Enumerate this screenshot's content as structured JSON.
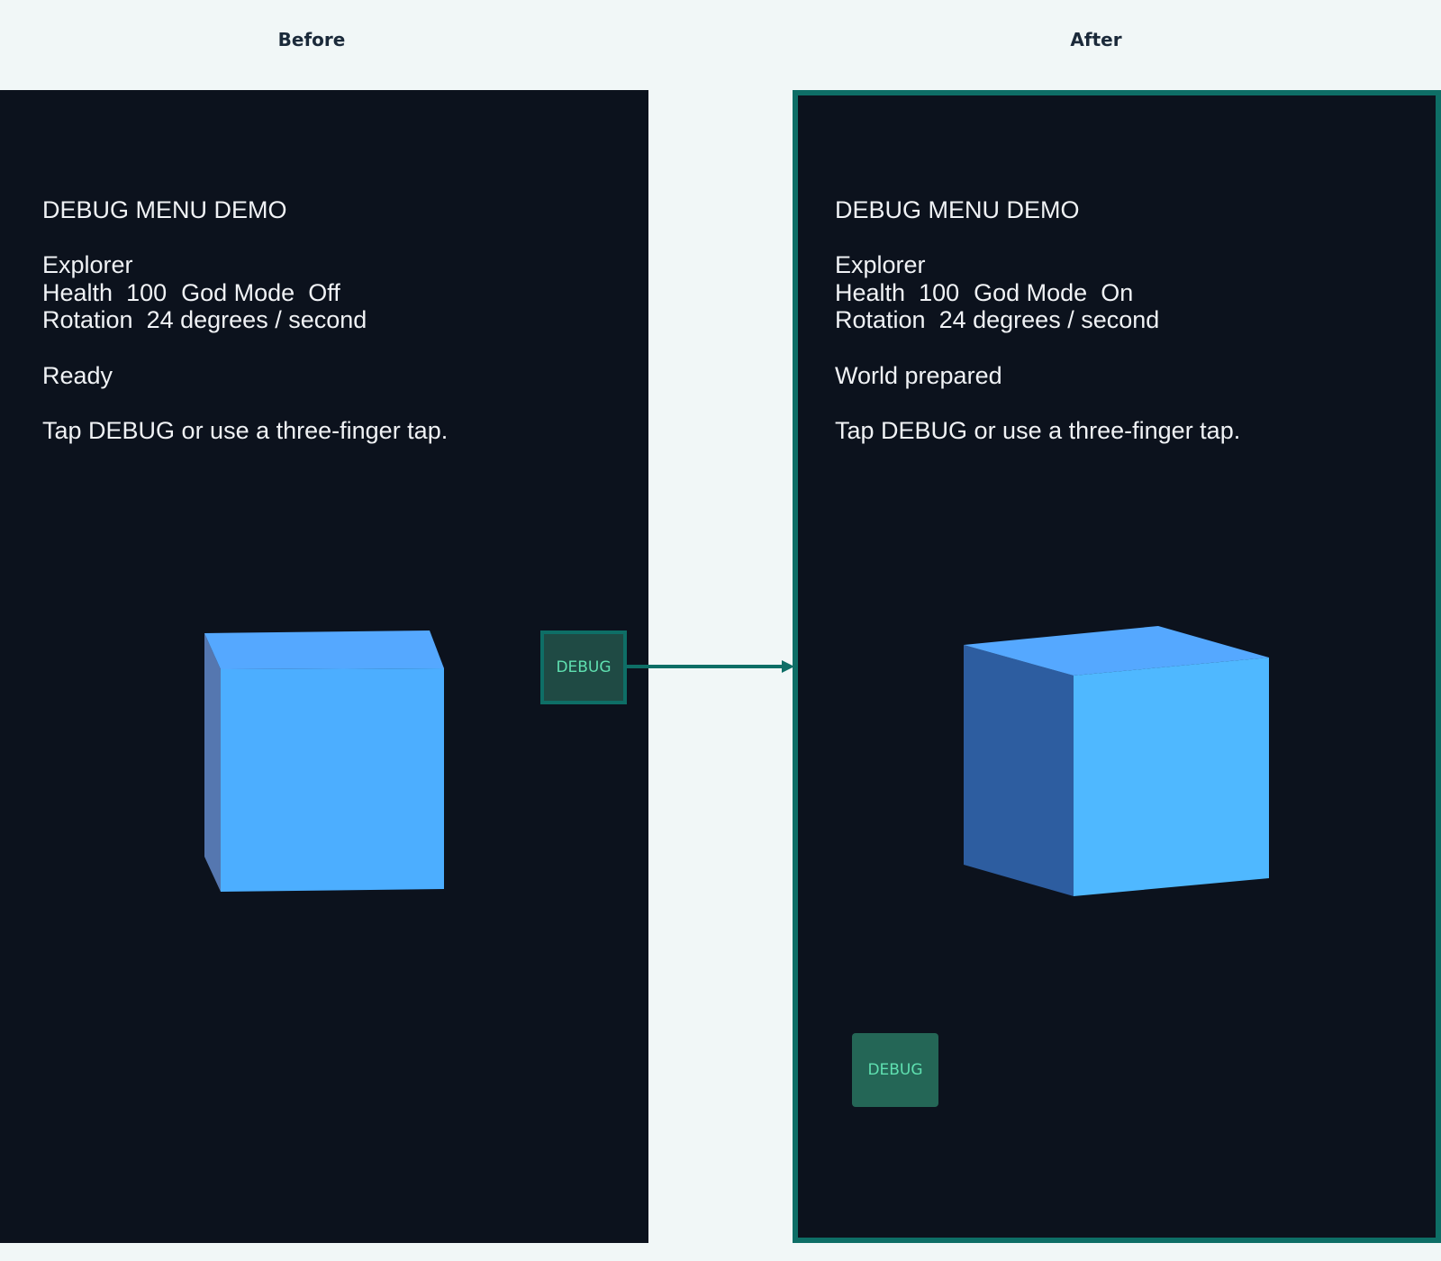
{
  "labels": {
    "before": "Before",
    "after": "After"
  },
  "before": {
    "title": "DEBUG MENU DEMO",
    "player_name": "Explorer",
    "health_label": "Health",
    "health_value": "100",
    "god_mode_label": "God Mode",
    "god_mode_value": "Off",
    "rotation_label": "Rotation",
    "rotation_value": "24 degrees / second",
    "status": "Ready",
    "hint": "Tap DEBUG or use a three-finger tap.",
    "debug_button_label": "DEBUG"
  },
  "after": {
    "title": "DEBUG MENU DEMO",
    "player_name": "Explorer",
    "health_label": "Health",
    "health_value": "100",
    "god_mode_label": "God Mode",
    "god_mode_value": "On",
    "rotation_label": "Rotation",
    "rotation_value": "24 degrees / second",
    "status": "World prepared",
    "hint": "Tap DEBUG or use a three-finger tap.",
    "debug_button_label": "DEBUG"
  },
  "colors": {
    "panel_background": "#0c121d",
    "accent_teal": "#0e6e66",
    "debug_text": "#5fe0b0",
    "cube_front": "#4fb2ff",
    "cube_top": "#55a8ff",
    "cube_side": "#2d5da0"
  }
}
